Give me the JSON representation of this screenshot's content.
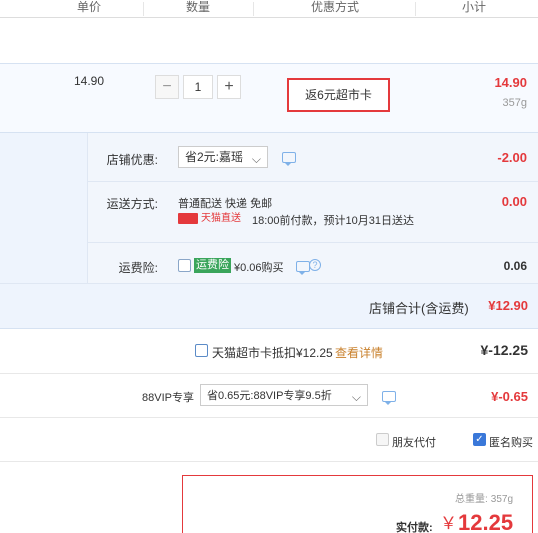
{
  "header": {
    "unit_price": "单价",
    "quantity": "数量",
    "promotion": "优惠方式",
    "subtotal": "小计"
  },
  "item": {
    "unit_price": "14.90",
    "quantity": "1",
    "minus": "−",
    "plus": "+",
    "promo": "返6元超市卡",
    "subtotal": "14.90",
    "weight": "357g"
  },
  "shop": {
    "discount_label": "店铺优惠:",
    "discount_select": "省2元:嘉瑶",
    "discount_value": "-2.00",
    "shipping_label": "运送方式:",
    "shipping_method": "普通配送 快递 免邮",
    "tmall_badge": "天猫直送",
    "shipping_note": "18:00前付款，预计10月31日送达",
    "shipping_value": "0.00",
    "insurance_label": "运费险:",
    "insurance_tag": "运费险",
    "insurance_text": "¥0.06购买",
    "insurance_value": "0.06",
    "total_label": "店铺合计(含运费)",
    "total_value": "¥12.90"
  },
  "card": {
    "label": "天猫超市卡抵扣¥12.25",
    "details_link": "查看详情",
    "value": "¥-12.25"
  },
  "vip": {
    "label": "88VIP专享",
    "select": "省0.65元:88VIP专享9.5折",
    "value": "¥-0.65"
  },
  "options": {
    "friend_pay": "朋友代付",
    "anonymous": "匿名购买",
    "anonymous_checked": true
  },
  "payment": {
    "weight_label": "总重量:",
    "weight": "357g",
    "pay_label": "实付款:",
    "currency": "￥",
    "amount": "12.25"
  },
  "colors": {
    "accent_red": "#e4393c",
    "link_blue": "#3a78d9",
    "tag_green": "#3aa55b"
  }
}
